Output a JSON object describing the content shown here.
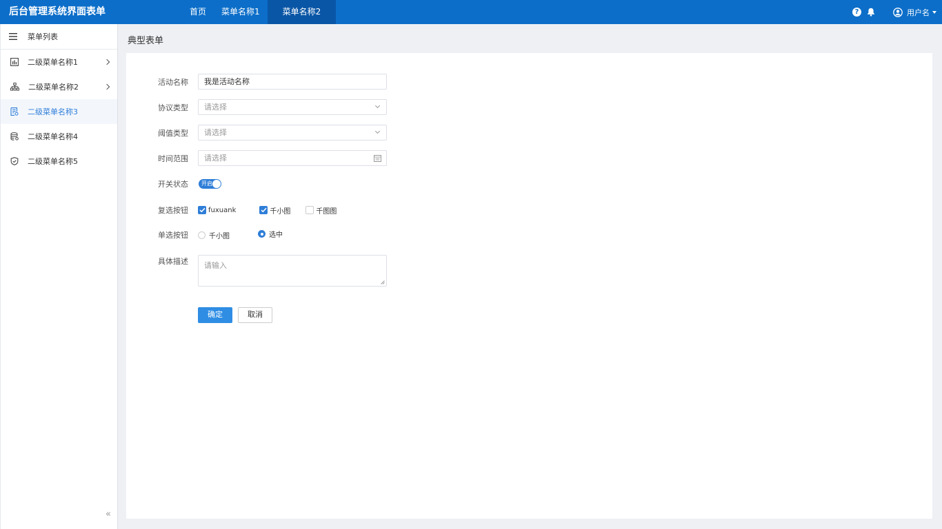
{
  "app": {
    "title": "后台管理系统界面表单"
  },
  "topnav": {
    "items": [
      {
        "label": "首页"
      },
      {
        "label": "菜单名称1"
      },
      {
        "label": "菜单名称2"
      }
    ],
    "active_index": 2
  },
  "topright": {
    "help_icon": "question-circle-icon",
    "bell_icon": "bell-icon",
    "user_icon": "user-circle-icon",
    "username": "用户名"
  },
  "sidebar": {
    "header": "菜单列表",
    "items": [
      {
        "label": "二级菜单名称1",
        "icon": "bar-chart-icon",
        "has_children": true
      },
      {
        "label": "二级菜单名称2",
        "icon": "org-chart-icon",
        "has_children": true
      },
      {
        "label": "二级菜单名称3",
        "icon": "document-icon",
        "active": true
      },
      {
        "label": "二级菜单名称4",
        "icon": "database-icon"
      },
      {
        "label": "二级菜单名称5",
        "icon": "shield-icon"
      }
    ],
    "collapse_label": "«"
  },
  "page": {
    "title": "典型表单"
  },
  "form": {
    "activity_name": {
      "label": "活动名称",
      "value": "我是活动名称"
    },
    "protocol_type": {
      "label": "协议类型",
      "placeholder": "请选择"
    },
    "threshold_type": {
      "label": "阈值类型",
      "placeholder": "请选择"
    },
    "time_range": {
      "label": "时间范围",
      "placeholder": "请选择"
    },
    "switch": {
      "label": "开关状态",
      "on_text": "开启",
      "value": true
    },
    "checkbox": {
      "label": "复选按钮",
      "options": [
        {
          "label": "fuxuank",
          "checked": true
        },
        {
          "label": "千小图",
          "checked": true
        },
        {
          "label": "千图图",
          "checked": false
        }
      ]
    },
    "radio": {
      "label": "单选按钮",
      "options": [
        {
          "label": "千小图",
          "checked": false
        },
        {
          "label": "选中",
          "checked": true
        }
      ]
    },
    "description": {
      "label": "具体描述",
      "placeholder": "请输入"
    },
    "buttons": {
      "confirm": "确定",
      "cancel": "取消"
    }
  },
  "colors": {
    "topbar": "#0c6ec9",
    "topbar_active": "#0a56a6",
    "accent": "#2f7ed8",
    "background": "#eef0f4"
  }
}
